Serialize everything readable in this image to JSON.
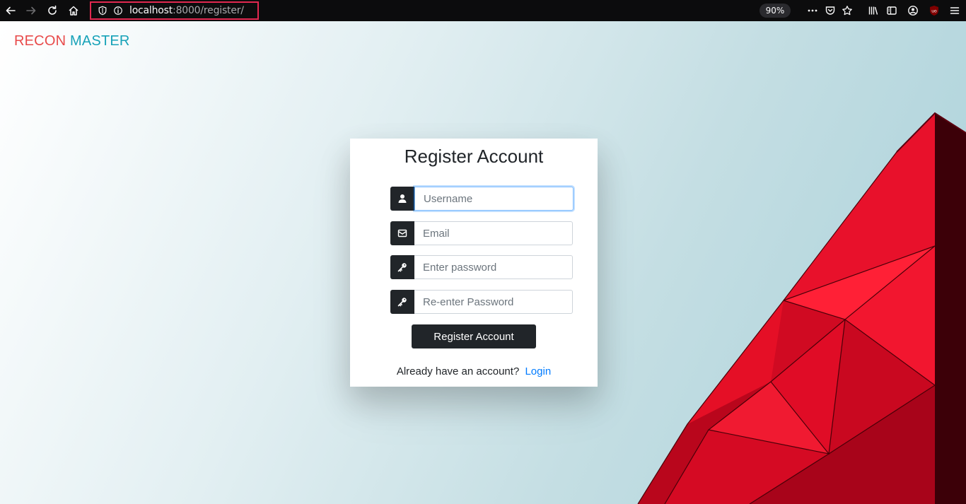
{
  "browser": {
    "url_host": "localhost",
    "url_rest": ":8000/register/",
    "zoom": "90%"
  },
  "brand": {
    "part1": "RECON",
    "part2": "MASTER"
  },
  "form": {
    "title": "Register Account",
    "fields": [
      {
        "placeholder": "Username",
        "icon": "user-icon",
        "focused": true
      },
      {
        "placeholder": "Email",
        "icon": "envelope-icon",
        "focused": false
      },
      {
        "placeholder": "Enter password",
        "icon": "key-icon",
        "focused": false
      },
      {
        "placeholder": "Re-enter Password",
        "icon": "key-icon",
        "focused": false
      }
    ],
    "submit_label": "Register Account",
    "login_prompt": "Already have an account?",
    "login_link": "Login"
  },
  "colors": {
    "brand_red": "#e84a4a",
    "brand_teal": "#17a2b8",
    "button_dark": "#212529",
    "link_blue": "#007bff",
    "decor_red": "#e8102a"
  }
}
